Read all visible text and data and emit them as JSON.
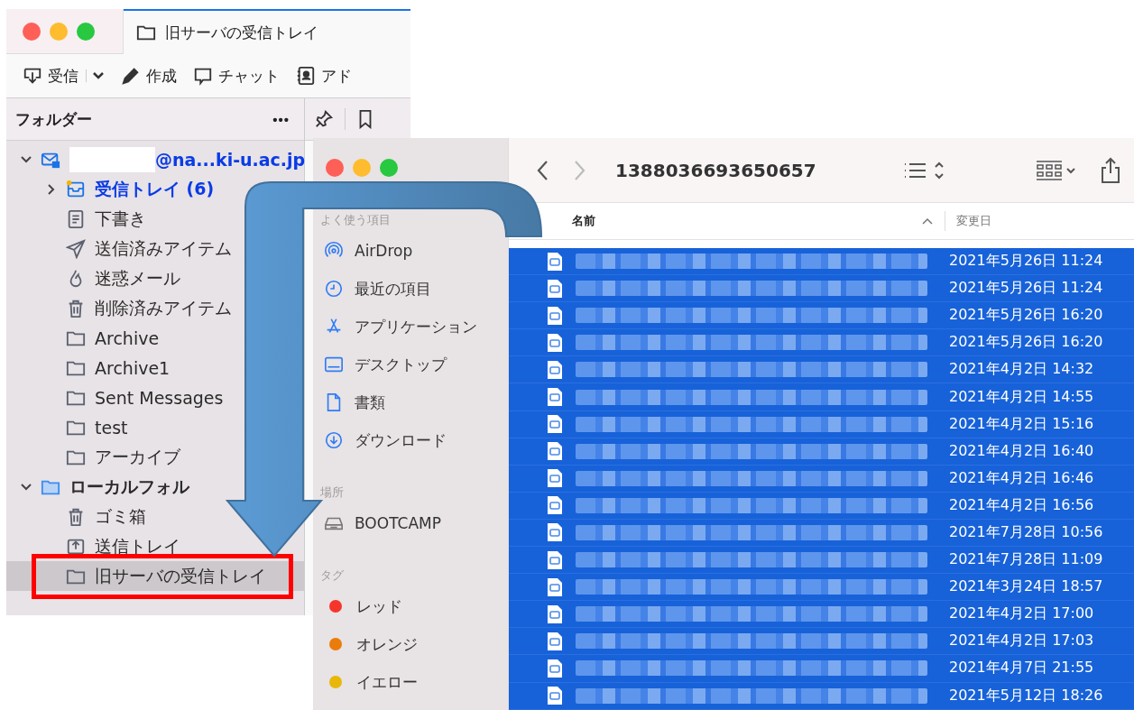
{
  "mail_window": {
    "tab_title": "旧サーバの受信トレイ",
    "toolbar": [
      {
        "kind": "receive",
        "label": "受信"
      },
      {
        "kind": "compose",
        "label": "作成"
      },
      {
        "kind": "chat",
        "label": "チャット"
      },
      {
        "kind": "address",
        "label": "アド"
      }
    ],
    "folder_pane": {
      "title": "フォルダー",
      "menu": "•••"
    },
    "tree": [
      {
        "kind": "account",
        "label": "@na...ki-u.ac.jp",
        "expanded": true,
        "selected": false,
        "children": [
          {
            "kind": "inbox",
            "label": "受信トレイ (6)",
            "unread": true,
            "expanded": false,
            "selected": false
          },
          {
            "kind": "drafts",
            "label": "下書き",
            "unread": false,
            "selected": false
          },
          {
            "kind": "sent",
            "label": "送信済みアイテム",
            "unread": false,
            "selected": false
          },
          {
            "kind": "junk",
            "label": "迷惑メール",
            "unread": false,
            "selected": false
          },
          {
            "kind": "trash",
            "label": "削除済みアイテム",
            "unread": false,
            "selected": false
          },
          {
            "kind": "folder",
            "label": "Archive",
            "unread": false,
            "selected": false
          },
          {
            "kind": "folder",
            "label": "Archive1",
            "unread": false,
            "selected": false
          },
          {
            "kind": "folder",
            "label": "Sent Messages",
            "unread": false,
            "selected": false
          },
          {
            "kind": "folder",
            "label": "test",
            "unread": false,
            "selected": false
          },
          {
            "kind": "folder",
            "label": "アーカイブ",
            "unread": false,
            "selected": false
          }
        ]
      },
      {
        "kind": "local",
        "label": "ローカルフォル",
        "expanded": true,
        "selected": false,
        "children": [
          {
            "kind": "trash",
            "label": "ゴミ箱",
            "unread": false,
            "selected": false
          },
          {
            "kind": "outbox",
            "label": "送信トレイ",
            "unread": false,
            "selected": false
          },
          {
            "kind": "folder",
            "label": "旧サーバの受信トレイ",
            "unread": false,
            "selected": true
          }
        ]
      }
    ]
  },
  "finder": {
    "path_title": "1388036693650657",
    "sidebar": [
      {
        "heading": "よく使う項目",
        "items": [
          {
            "kind": "airdrop",
            "label": "AirDrop"
          },
          {
            "kind": "recent",
            "label": "最近の項目"
          },
          {
            "kind": "apps",
            "label": "アプリケーション"
          },
          {
            "kind": "desktop",
            "label": "デスクトップ"
          },
          {
            "kind": "docs",
            "label": "書類"
          },
          {
            "kind": "download",
            "label": "ダウンロード"
          }
        ]
      },
      {
        "heading": "場所",
        "items": [
          {
            "kind": "drive",
            "label": "BOOTCAMP"
          }
        ]
      },
      {
        "heading": "タグ",
        "items": [
          {
            "kind": "tag",
            "label": "レッド",
            "color": "#f5352b"
          },
          {
            "kind": "tag",
            "label": "オレンジ",
            "color": "#ea7c0c"
          },
          {
            "kind": "tag",
            "label": "イエロー",
            "color": "#e9b70a"
          }
        ]
      }
    ],
    "columns": [
      "名前",
      "変更日"
    ],
    "rows": [
      {
        "date": "2021年5月26日 11:24",
        "selected": true
      },
      {
        "date": "2021年5月26日 11:24",
        "selected": true
      },
      {
        "date": "2021年5月26日 16:20",
        "selected": true
      },
      {
        "date": "2021年5月26日 16:20",
        "selected": true
      },
      {
        "date": "2021年4月2日 14:32",
        "selected": true
      },
      {
        "date": "2021年4月2日 14:55",
        "selected": true
      },
      {
        "date": "2021年4月2日 15:16",
        "selected": true
      },
      {
        "date": "2021年4月2日 16:40",
        "selected": true
      },
      {
        "date": "2021年4月2日 16:46",
        "selected": true
      },
      {
        "date": "2021年4月2日 16:56",
        "selected": true
      },
      {
        "date": "2021年7月28日 10:56",
        "selected": true
      },
      {
        "date": "2021年7月28日 11:09",
        "selected": true
      },
      {
        "date": "2021年3月24日 18:57",
        "selected": true
      },
      {
        "date": "2021年4月2日 17:00",
        "selected": true
      },
      {
        "date": "2021年4月2日 17:03",
        "selected": true
      },
      {
        "date": "2021年4月7日 21:55",
        "selected": true
      },
      {
        "date": "2021年5月12日 18:26",
        "selected": true
      }
    ]
  }
}
